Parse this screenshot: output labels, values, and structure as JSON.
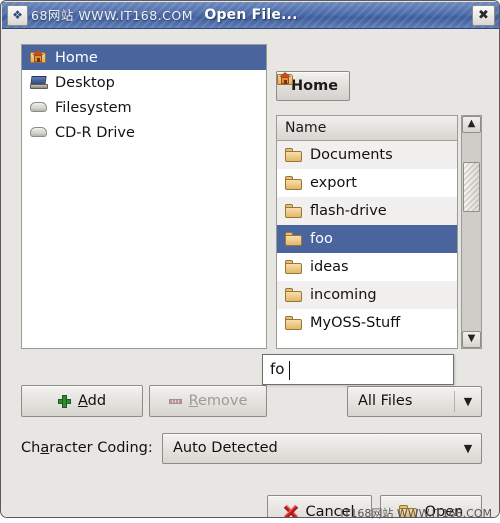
{
  "window": {
    "title": "Open File...",
    "menu_icon": "window-menu-icon",
    "close_icon": "close-icon"
  },
  "watermarks": {
    "top": "68网站 WWW.IT168.COM",
    "bottom": "IT168网站 WWW.IT168.COM"
  },
  "places": {
    "items": [
      {
        "label": "Home",
        "icon": "home-folder-icon",
        "selected": true
      },
      {
        "label": "Desktop",
        "icon": "desktop-icon",
        "selected": false
      },
      {
        "label": "Filesystem",
        "icon": "disk-icon",
        "selected": false
      },
      {
        "label": "CD-R Drive",
        "icon": "disk-icon",
        "selected": false
      }
    ]
  },
  "path_bar": {
    "current": "Home",
    "icon": "home-folder-icon"
  },
  "file_list": {
    "column_header": "Name",
    "rows": [
      {
        "name": "Documents",
        "icon": "folder-icon",
        "selected": false
      },
      {
        "name": "export",
        "icon": "folder-icon",
        "selected": false
      },
      {
        "name": "flash-drive",
        "icon": "folder-icon",
        "selected": false
      },
      {
        "name": "foo",
        "icon": "folder-icon",
        "selected": true
      },
      {
        "name": "ideas",
        "icon": "folder-icon",
        "selected": false
      },
      {
        "name": "incoming",
        "icon": "folder-icon",
        "selected": false
      },
      {
        "name": "MyOSS-Stuff",
        "icon": "folder-icon",
        "selected": false
      }
    ]
  },
  "scrollbar": {
    "up_arrow": "▲",
    "down_arrow": "▼"
  },
  "location_entry": {
    "value": "fo",
    "placeholder": ""
  },
  "buttons": {
    "add": {
      "label": "Add",
      "mnemonic": "A",
      "icon": "plus-icon",
      "disabled": false
    },
    "remove": {
      "label": "Remove",
      "mnemonic": "R",
      "icon": "minus-bar-icon",
      "disabled": true
    },
    "cancel": {
      "label": "Cancel",
      "mnemonic": "C",
      "icon": "red-x-icon",
      "disabled": false
    },
    "open": {
      "label": "Open",
      "mnemonic": "O",
      "icon": "open-folder-icon",
      "disabled": false
    }
  },
  "file_type_combo": {
    "value": "All Files",
    "arrow": "▼"
  },
  "encoding": {
    "label_before": "Ch",
    "label_mnemonic": "a",
    "label_after": "racter Coding:",
    "value": "Auto Detected",
    "arrow": "▼"
  },
  "colors": {
    "selection_blue": "#4a659e",
    "titlebar_blue": "#4e6ca8",
    "dialog_bg": "#e8e6e3"
  }
}
